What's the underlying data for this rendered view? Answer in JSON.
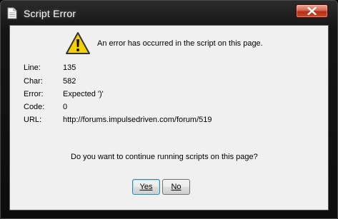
{
  "window": {
    "title": "Script Error"
  },
  "message": "An error has occurred in the script on this page.",
  "details": [
    {
      "label": "Line:",
      "value": "135"
    },
    {
      "label": "Char:",
      "value": "582"
    },
    {
      "label": "Error:",
      "value": "Expected ')'"
    },
    {
      "label": "Code:",
      "value": "0"
    },
    {
      "label": "URL:",
      "value": "http://forums.impulsedriven.com/forum/519"
    }
  ],
  "question": "Do you want to continue running scripts on this page?",
  "buttons": {
    "yes_label": "Yes",
    "no_label": "No"
  },
  "colors": {
    "close_button": "#c54a2c",
    "warning_yellow": "#f5d100",
    "dialog_background": "#f0f0f0"
  },
  "icons": {
    "title": "document-icon",
    "close": "close-icon",
    "message": "warning-icon"
  }
}
